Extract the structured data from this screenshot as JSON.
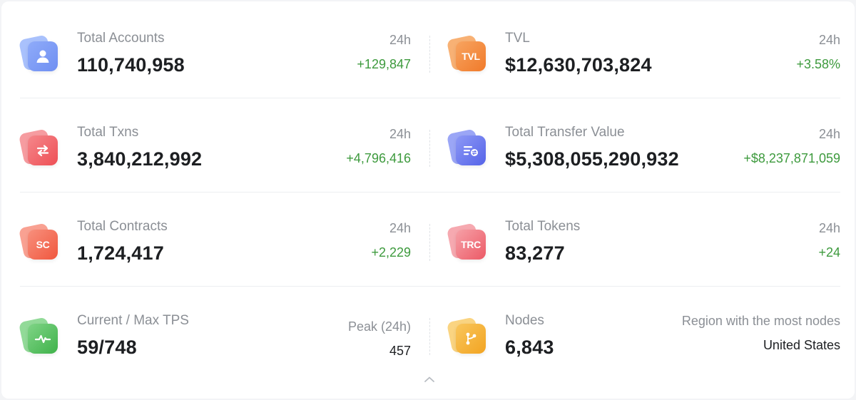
{
  "colors": {
    "accounts": [
      "#6f8ff2",
      "#9ab6fb"
    ],
    "tvl": [
      "#f07a2a",
      "#f7a35c"
    ],
    "txns": [
      "#ee4f55",
      "#f58b8f"
    ],
    "transfer": [
      "#5563e8",
      "#8a96f5"
    ],
    "contracts": [
      "#f0573e",
      "#f8917f"
    ],
    "tokens": [
      "#ec5a66",
      "#f59aa2"
    ],
    "tps": [
      "#3fb24a",
      "#7fd486"
    ],
    "nodes": [
      "#f2a422",
      "#f9cd6b"
    ],
    "positive": "#3d9a3d"
  },
  "stats": {
    "accounts": {
      "icon": "user-icon",
      "label": "Total Accounts",
      "value": "110,740,958",
      "period": "24h",
      "change": "+129,847"
    },
    "tvl": {
      "icon": "tvl-icon",
      "icon_text": "TVL",
      "label": "TVL",
      "value": "$12,630,703,824",
      "period": "24h",
      "change": "+3.58%"
    },
    "txns": {
      "icon": "transfer-arrows-icon",
      "label": "Total Txns",
      "value": "3,840,212,992",
      "period": "24h",
      "change": "+4,796,416"
    },
    "transfer_value": {
      "icon": "transfer-value-icon",
      "label": "Total Transfer Value",
      "value": "$5,308,055,290,932",
      "period": "24h",
      "change": "+$8,237,871,059"
    },
    "contracts": {
      "icon": "smart-contract-icon",
      "icon_text": "SC",
      "label": "Total Contracts",
      "value": "1,724,417",
      "period": "24h",
      "change": "+2,229"
    },
    "tokens": {
      "icon": "trc-token-icon",
      "icon_text": "TRC",
      "label": "Total Tokens",
      "value": "83,277",
      "period": "24h",
      "change": "+24"
    },
    "tps": {
      "icon": "pulse-icon",
      "label": "Current / Max TPS",
      "value": "59/748",
      "peak_label": "Peak (24h)",
      "peak_value": "457"
    },
    "nodes": {
      "icon": "network-nodes-icon",
      "label": "Nodes",
      "value": "6,843",
      "region_label": "Region with the most nodes",
      "region_value": "United States"
    }
  },
  "collapse_icon": "chevron-up-icon"
}
